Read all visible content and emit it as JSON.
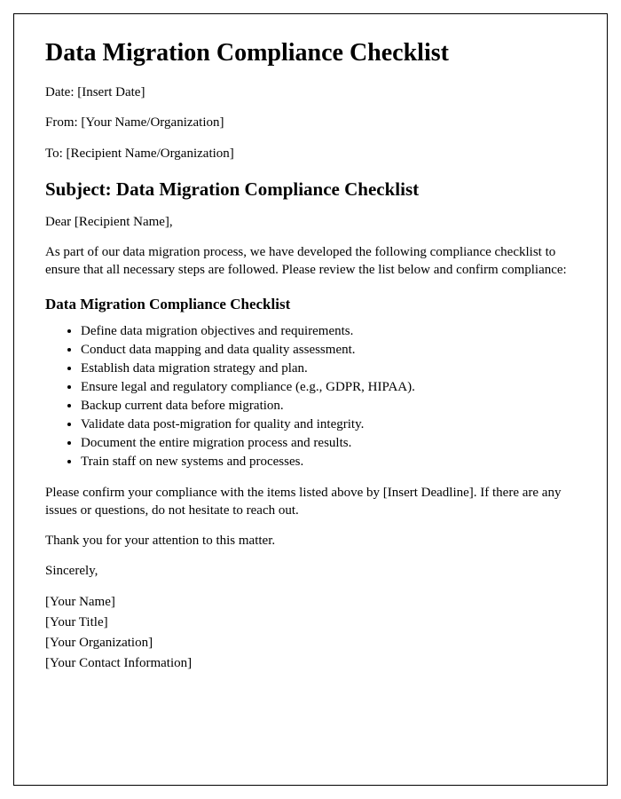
{
  "title": "Data Migration Compliance Checklist",
  "header": {
    "date": "Date: [Insert Date]",
    "from": "From: [Your Name/Organization]",
    "to": "To: [Recipient Name/Organization]"
  },
  "subject": "Subject: Data Migration Compliance Checklist",
  "salutation": "Dear [Recipient Name],",
  "intro": "As part of our data migration process, we have developed the following compliance checklist to ensure that all necessary steps are followed. Please review the list below and confirm compliance:",
  "checklist_heading": "Data Migration Compliance Checklist",
  "checklist": [
    "Define data migration objectives and requirements.",
    "Conduct data mapping and data quality assessment.",
    "Establish data migration strategy and plan.",
    "Ensure legal and regulatory compliance (e.g., GDPR, HIPAA).",
    "Backup current data before migration.",
    "Validate data post-migration for quality and integrity.",
    "Document the entire migration process and results.",
    "Train staff on new systems and processes."
  ],
  "closing_request": "Please confirm your compliance with the items listed above by [Insert Deadline]. If there are any issues or questions, do not hesitate to reach out.",
  "thanks": "Thank you for your attention to this matter.",
  "signoff": "Sincerely,",
  "signature": {
    "name": "[Your Name]",
    "title_line": "[Your Title]",
    "organization": "[Your Organization]",
    "contact": "[Your Contact Information]"
  }
}
